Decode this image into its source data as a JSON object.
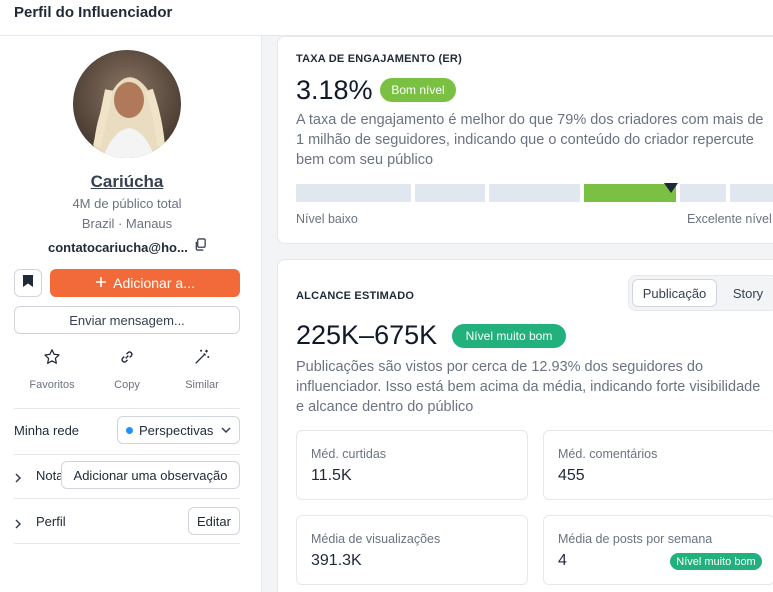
{
  "header": {
    "title": "Perfil do Influenciador"
  },
  "profile": {
    "name": "Cariúcha",
    "audience": "4M de público total",
    "location": "Brazil · Manaus",
    "email": "contatocariucha@ho..."
  },
  "buttons": {
    "add": "Adicionar a...",
    "message": "Enviar mensagem...",
    "add_note": "Adicionar uma observação",
    "edit": "Editar"
  },
  "actions": [
    {
      "label": "Favoritos",
      "icon": "star-icon"
    },
    {
      "label": "Copy",
      "icon": "link-icon"
    },
    {
      "label": "Similar",
      "icon": "magic-wand-icon"
    }
  ],
  "network": {
    "label": "Minha rede",
    "selected": "Perspectivas"
  },
  "notes": {
    "label": "Nota"
  },
  "perfil": {
    "label": "Perfil"
  },
  "engagement": {
    "label": "TAXA DE ENGAJAMENTO (ER)",
    "value": "3.18%",
    "badge": "Bom nível",
    "description": "A taxa de engajamento é melhor do que 79% dos criadores com mais de 1 milhão de seguidores, indicando que o conteúdo do criador repercute bem com seu público",
    "scale_low": "Nível baixo",
    "scale_high": "Excelente nível",
    "active_segment": 4,
    "percentile": 79,
    "colors": {
      "active": "#7ac143",
      "inactive": "#e1e7ef",
      "badge": "#7ac143"
    }
  },
  "reach": {
    "label": "ALCANCE ESTIMADO",
    "value": "225K–675K",
    "badge": "Nível muito bom",
    "description": "Publicações são vistos por cerca de 12.93% dos seguidores do influenciador. Isso está bem acima da média, indicando forte visibilidade e alcance dentro do público",
    "tabs": [
      "Publicação",
      "Story"
    ],
    "active_tab": "Publicação",
    "colors": {
      "badge": "#22b07d"
    }
  },
  "metrics": [
    {
      "label": "Méd. curtidas",
      "value": "11.5K"
    },
    {
      "label": "Méd. comentários",
      "value": "455"
    },
    {
      "label": "Média de visualizações",
      "value": "391.3K"
    },
    {
      "label": "Média de posts por semana",
      "value": "4",
      "badge": "Nível muito bom"
    }
  ]
}
